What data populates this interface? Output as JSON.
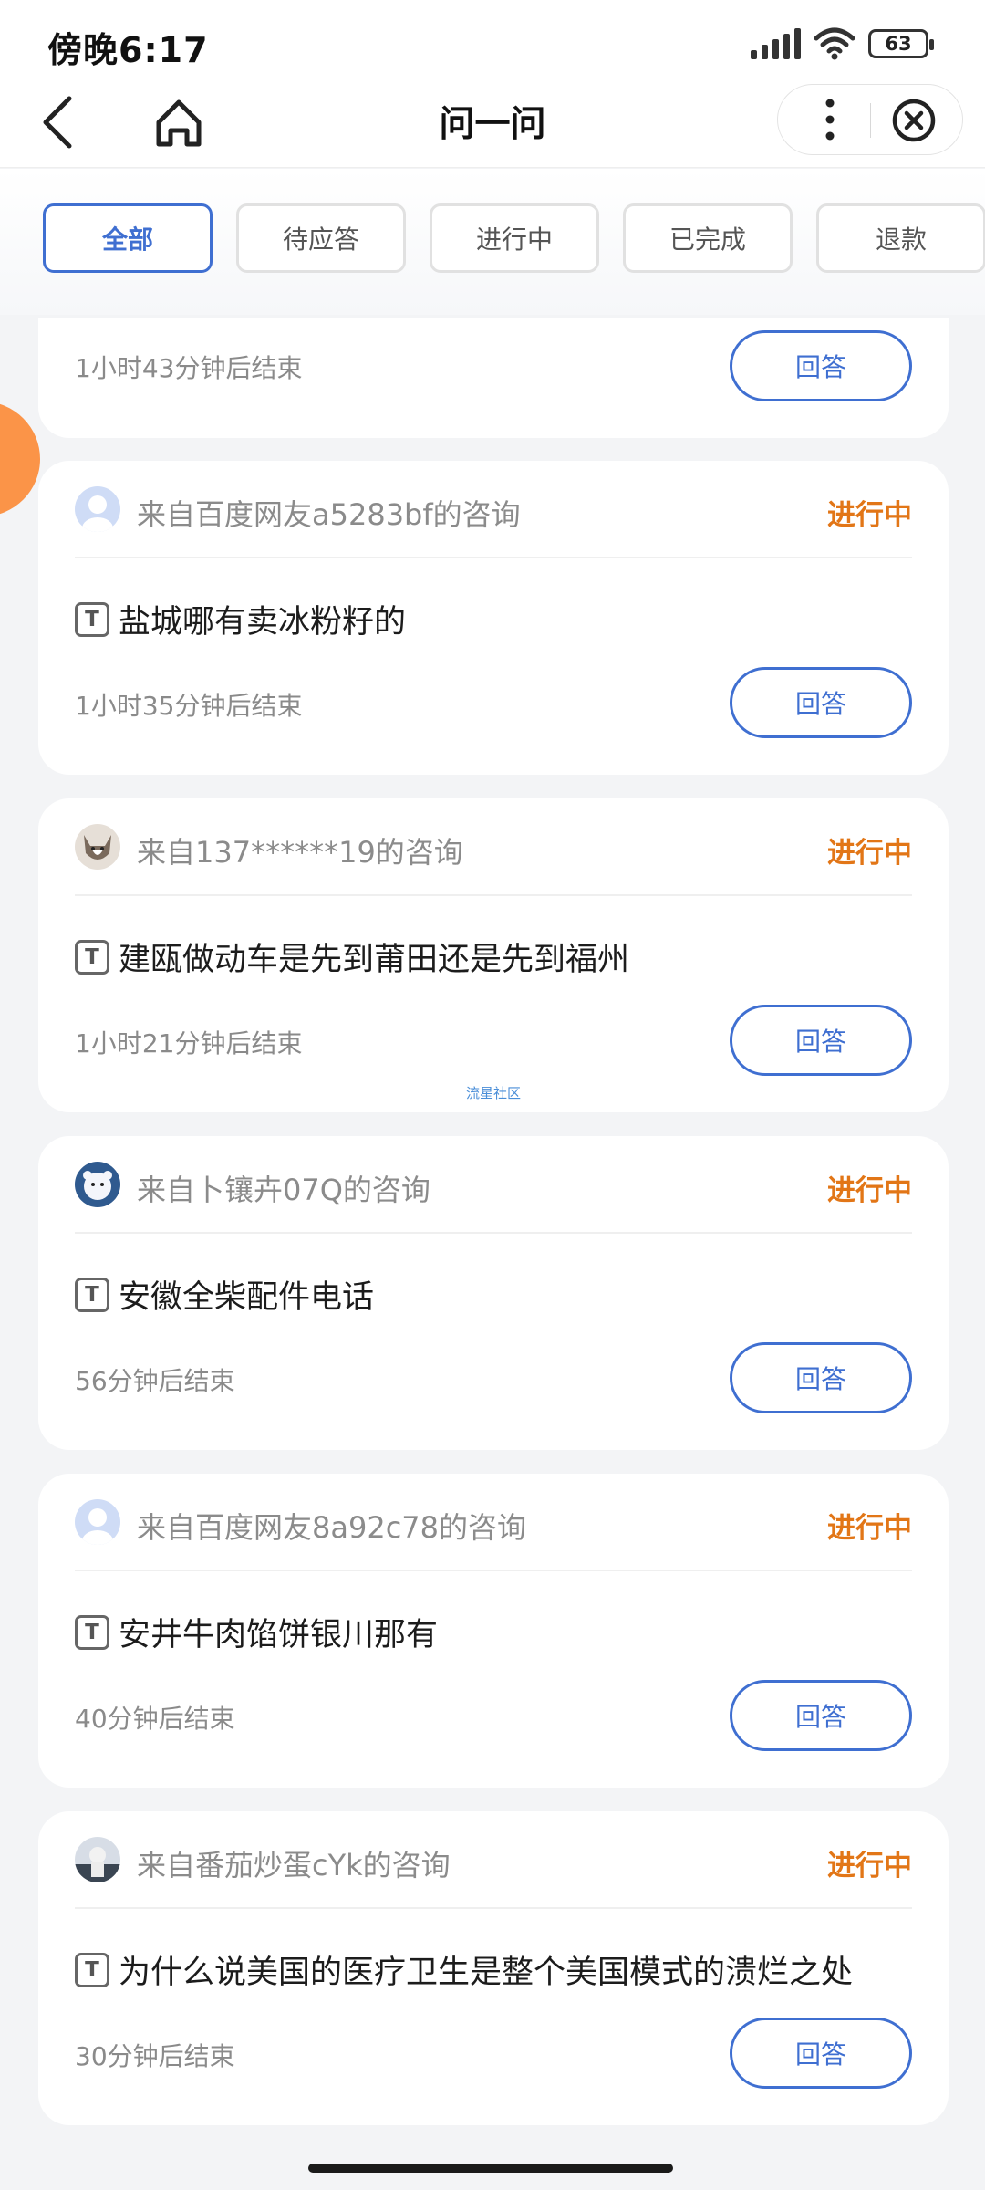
{
  "status_bar": {
    "time": "傍晚6:17",
    "battery": "63"
  },
  "nav": {
    "title": "问一问",
    "icons": [
      "back-icon",
      "home-icon",
      "more-icon",
      "close-icon"
    ]
  },
  "tabs": [
    {
      "label": "全部",
      "active": true
    },
    {
      "label": "待应答",
      "active": false
    },
    {
      "label": "进行中",
      "active": false
    },
    {
      "label": "已完成",
      "active": false
    },
    {
      "label": "退款",
      "active": false
    }
  ],
  "partial_card": {
    "deadline": "1小时43分钟后结束",
    "button": "回答"
  },
  "cards": [
    {
      "source": "来自百度网友a5283bf的咨询",
      "status": "进行中",
      "question": "盐城哪有卖冰粉籽的",
      "deadline": "1小时35分钟后结束",
      "button": "回答",
      "avatar": "default-avatar"
    },
    {
      "source": "来自137******19的咨询",
      "status": "进行中",
      "question": "建瓯做动车是先到莆田还是先到福州",
      "deadline": "1小时21分钟后结束",
      "button": "回答",
      "avatar": "cat-avatar",
      "watermark": "流星社区"
    },
    {
      "source": "来自卜镶卉07Q的咨询",
      "status": "进行中",
      "question": "安徽全柴配件电话",
      "deadline": "56分钟后结束",
      "button": "回答",
      "avatar": "bear-avatar"
    },
    {
      "source": "来自百度网友8a92c78的咨询",
      "status": "进行中",
      "question": "安井牛肉馅饼银川那有",
      "deadline": "40分钟后结束",
      "button": "回答",
      "avatar": "default-avatar"
    },
    {
      "source": "来自番茄炒蛋cYk的咨询",
      "status": "进行中",
      "question": "为什么说美国的医疗卫生是整个美国模式的溃烂之处",
      "deadline": "30分钟后结束",
      "button": "回答",
      "avatar": "photo-avatar"
    }
  ],
  "colors": {
    "accent": "#3f6fd1",
    "status": "#e27617",
    "background": "#f3f4f6",
    "float_button": "#fb9448"
  }
}
